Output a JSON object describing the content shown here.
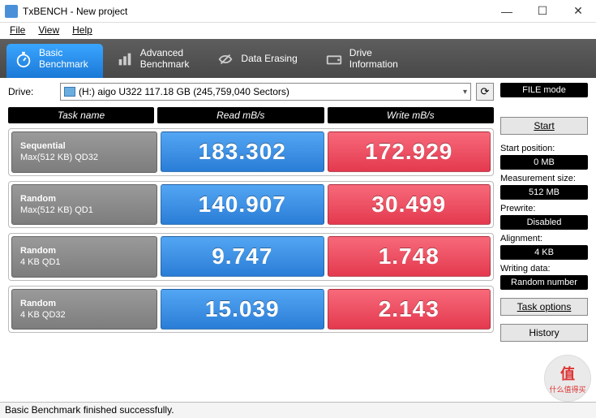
{
  "window": {
    "title": "TxBENCH - New project",
    "minimize": "—",
    "maximize": "☐",
    "close": "✕"
  },
  "menu": {
    "file": "File",
    "view": "View",
    "help": "Help"
  },
  "tabs": {
    "basic": "Basic\nBenchmark",
    "advanced": "Advanced\nBenchmark",
    "erasing": "Data Erasing",
    "drive": "Drive\nInformation"
  },
  "drive": {
    "label": "Drive:",
    "value": "(H:) aigo U322  117.18 GB (245,759,040 Sectors)",
    "refresh_icon": "⟳"
  },
  "headers": {
    "task": "Task name",
    "read": "Read mB/s",
    "write": "Write mB/s"
  },
  "tests": [
    {
      "name": "Sequential",
      "detail": "Max(512 KB) QD32",
      "read": "183.302",
      "write": "172.929"
    },
    {
      "name": "Random",
      "detail": "Max(512 KB) QD1",
      "read": "140.907",
      "write": "30.499"
    },
    {
      "name": "Random",
      "detail": "4 KB QD1",
      "read": "9.747",
      "write": "1.748"
    },
    {
      "name": "Random",
      "detail": "4 KB QD32",
      "read": "15.039",
      "write": "2.143"
    }
  ],
  "side": {
    "file_mode": "FILE mode",
    "start": "Start",
    "start_pos_lbl": "Start position:",
    "start_pos_val": "0 MB",
    "meas_lbl": "Measurement size:",
    "meas_val": "512 MB",
    "prewrite_lbl": "Prewrite:",
    "prewrite_val": "Disabled",
    "align_lbl": "Alignment:",
    "align_val": "4 KB",
    "wdata_lbl": "Writing data:",
    "wdata_val": "Random number",
    "task_opts": "Task options",
    "history": "History"
  },
  "status": "Basic Benchmark finished successfully.",
  "watermark": {
    "big": "值",
    "small": "什么值得买"
  }
}
